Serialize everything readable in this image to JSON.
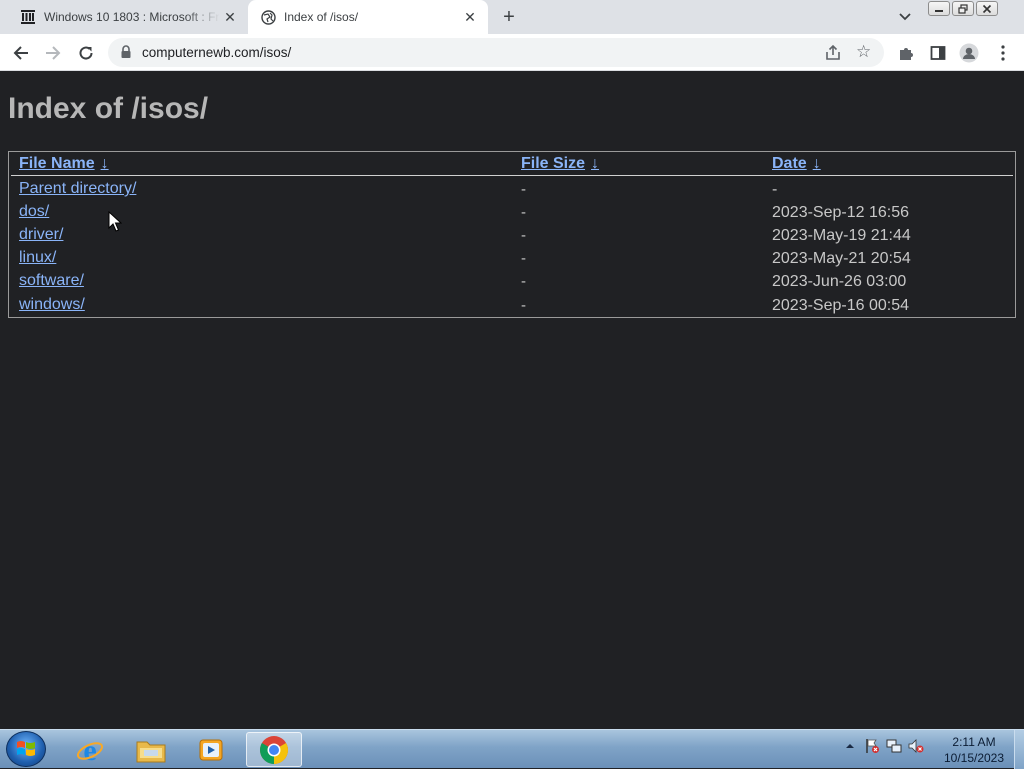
{
  "browser": {
    "tabs": [
      {
        "title": "Windows 10 1803 : Microsoft : Fr",
        "icon": "archive-columns-icon",
        "active": false
      },
      {
        "title": "Index of /isos/",
        "icon": "globe-icon",
        "active": true
      }
    ],
    "url": "computernewb.com/isos/"
  },
  "page": {
    "title": "Index of /isos/",
    "columns": [
      {
        "label": "File Name",
        "sort_glyph": "↓"
      },
      {
        "label": "File Size",
        "sort_glyph": "↓"
      },
      {
        "label": "Date",
        "sort_glyph": "↓"
      }
    ],
    "rows": [
      {
        "name": "Parent directory/",
        "size": "-",
        "date": "-"
      },
      {
        "name": "dos/",
        "size": "-",
        "date": "2023-Sep-12 16:56"
      },
      {
        "name": "driver/",
        "size": "-",
        "date": "2023-May-19 21:44"
      },
      {
        "name": "linux/",
        "size": "-",
        "date": "2023-May-21 20:54"
      },
      {
        "name": "software/",
        "size": "-",
        "date": "2023-Jun-26 03:00"
      },
      {
        "name": "windows/",
        "size": "-",
        "date": "2023-Sep-16 00:54"
      }
    ]
  },
  "taskbar": {
    "apps": [
      "internet-explorer-icon",
      "file-explorer-icon",
      "media-player-icon",
      "chrome-icon"
    ],
    "clock": {
      "time": "2:11 AM",
      "date": "10/15/2023"
    }
  },
  "colors": {
    "page_bg": "#202124",
    "link": "#8ab4f8",
    "text": "#c8c8c8",
    "heading": "#b7b7b7"
  }
}
